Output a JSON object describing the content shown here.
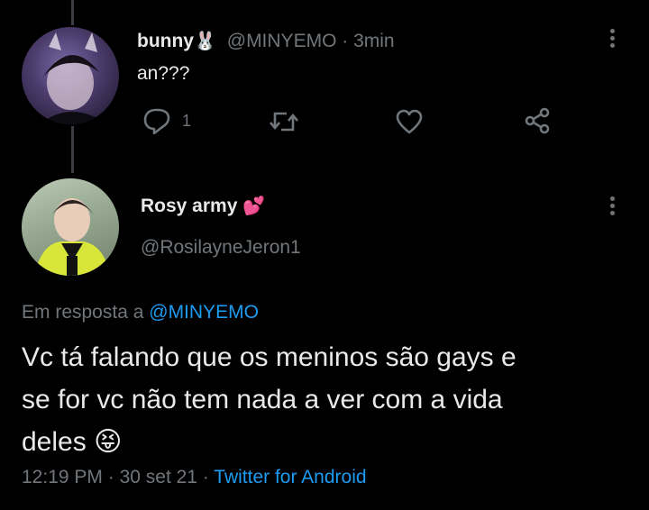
{
  "reply_tweet": {
    "display_name": "bunny",
    "name_emoji": "🐰",
    "handle": "@MINYEMO",
    "separator": "·",
    "time_ago": "3min",
    "text": "an???",
    "reply_count": "1",
    "icons": [
      "reply-icon",
      "retweet-icon",
      "like-icon",
      "share-icon"
    ]
  },
  "main_tweet": {
    "display_name": "Rosy army",
    "name_emoji": "💕",
    "handle": "@RosilayneJeron1",
    "reply_to_prefix": "Em resposta a",
    "reply_to_handle": "@MINYEMO",
    "text_line1": "Vc tá falando que os meninos são gays e",
    "text_line2": "se for vc não tem nada a ver com a vida",
    "text_line3": "deles",
    "text_emoji": "😝",
    "time": "12:19 PM",
    "date": "30 set 21",
    "dot1": "·",
    "dot2": "·",
    "source": "Twitter for Android"
  },
  "colors": {
    "background": "#000000",
    "link": "#1d9bf0",
    "muted": "#71767b",
    "text": "#e7e9ea"
  }
}
